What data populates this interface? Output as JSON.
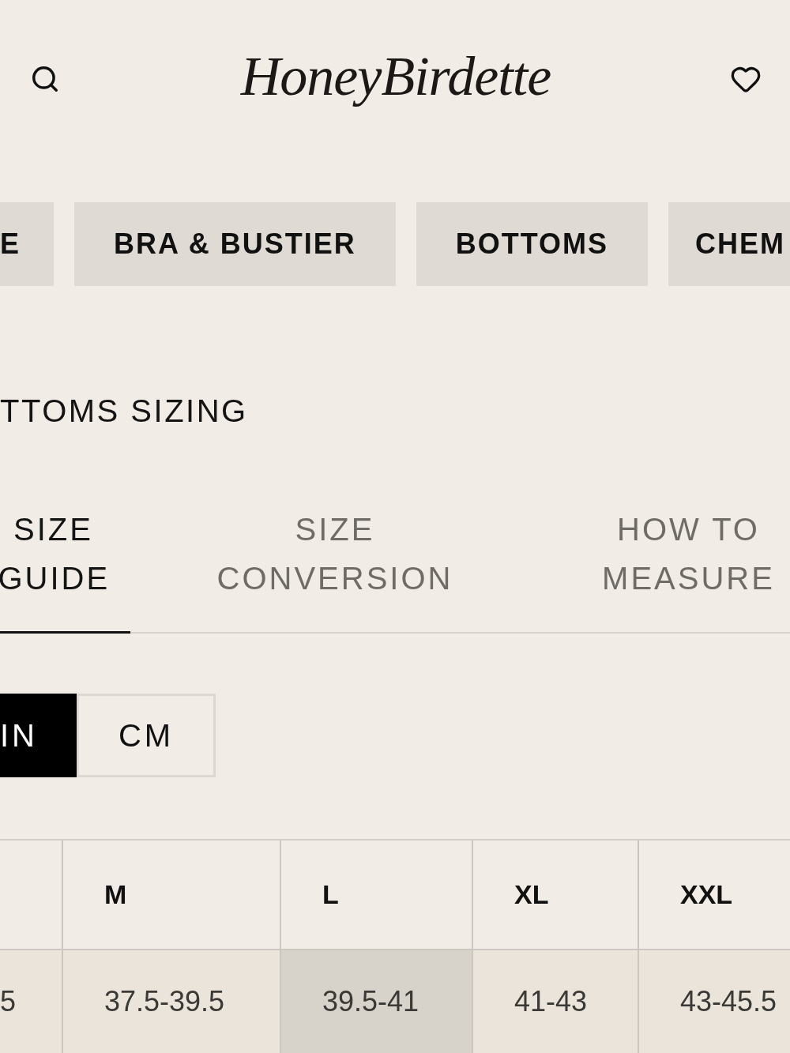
{
  "header": {
    "logo": "HoneyBirdette"
  },
  "categories": [
    "E",
    "BRA & BUSTIER",
    "BOTTOMS",
    "CHEM"
  ],
  "sizing": {
    "title": "TTOMS SIZING",
    "tabs": [
      {
        "label": "SIZE GUIDE",
        "selected": true
      },
      {
        "label": "SIZE CONVERSION",
        "selected": false
      },
      {
        "label": "HOW TO MEASURE",
        "selected": false
      }
    ],
    "units": [
      {
        "label": "IN",
        "selected": true
      },
      {
        "label": "CM",
        "selected": false
      }
    ],
    "table": {
      "columns": [
        "",
        "M",
        "L",
        "XL",
        "XXL"
      ],
      "rows": [
        {
          "cells": [
            {
              "value": "5",
              "highlighted": false
            },
            {
              "value": "37.5-39.5",
              "highlighted": false
            },
            {
              "value": "39.5-41",
              "highlighted": true
            },
            {
              "value": "41-43",
              "highlighted": false
            },
            {
              "value": "43-45.5",
              "highlighted": false
            }
          ]
        }
      ]
    }
  }
}
